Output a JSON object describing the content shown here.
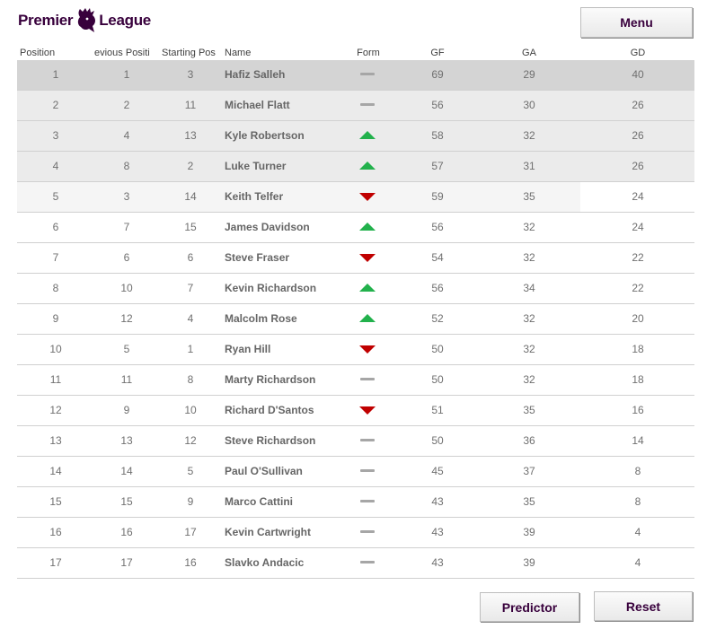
{
  "logo": {
    "word1": "Premier",
    "word2": "League"
  },
  "buttons": {
    "menu": "Menu",
    "predictor": "Predictor",
    "reset": "Reset"
  },
  "colors": {
    "brand": "#38003c",
    "up": "#22b14c",
    "down": "#c00000",
    "same": "#a6a6a6"
  },
  "table": {
    "headers": {
      "position": "Position",
      "previous": "evious Positi",
      "starting": "Starting Pos",
      "name": "Name",
      "form": "Form",
      "gf": "GF",
      "ga": "GA",
      "gd": "GD"
    },
    "rows": [
      {
        "pos": "1",
        "prev": "1",
        "start": "3",
        "name": "Hafiz Salleh",
        "form": "same",
        "gf": "69",
        "ga": "29",
        "gd": "40"
      },
      {
        "pos": "2",
        "prev": "2",
        "start": "11",
        "name": "Michael Flatt",
        "form": "same",
        "gf": "56",
        "ga": "30",
        "gd": "26"
      },
      {
        "pos": "3",
        "prev": "4",
        "start": "13",
        "name": "Kyle Robertson",
        "form": "up",
        "gf": "58",
        "ga": "32",
        "gd": "26"
      },
      {
        "pos": "4",
        "prev": "8",
        "start": "2",
        "name": "Luke Turner",
        "form": "up",
        "gf": "57",
        "ga": "31",
        "gd": "26"
      },
      {
        "pos": "5",
        "prev": "3",
        "start": "14",
        "name": "Keith Telfer",
        "form": "down",
        "gf": "59",
        "ga": "35",
        "gd": "24"
      },
      {
        "pos": "6",
        "prev": "7",
        "start": "15",
        "name": "James Davidson",
        "form": "up",
        "gf": "56",
        "ga": "32",
        "gd": "24"
      },
      {
        "pos": "7",
        "prev": "6",
        "start": "6",
        "name": "Steve Fraser",
        "form": "down",
        "gf": "54",
        "ga": "32",
        "gd": "22"
      },
      {
        "pos": "8",
        "prev": "10",
        "start": "7",
        "name": "Kevin Richardson",
        "form": "up",
        "gf": "56",
        "ga": "34",
        "gd": "22"
      },
      {
        "pos": "9",
        "prev": "12",
        "start": "4",
        "name": "Malcolm Rose",
        "form": "up",
        "gf": "52",
        "ga": "32",
        "gd": "20"
      },
      {
        "pos": "10",
        "prev": "5",
        "start": "1",
        "name": "Ryan Hill",
        "form": "down",
        "gf": "50",
        "ga": "32",
        "gd": "18"
      },
      {
        "pos": "11",
        "prev": "11",
        "start": "8",
        "name": "Marty Richardson",
        "form": "same",
        "gf": "50",
        "ga": "32",
        "gd": "18"
      },
      {
        "pos": "12",
        "prev": "9",
        "start": "10",
        "name": "Richard D'Santos",
        "form": "down",
        "gf": "51",
        "ga": "35",
        "gd": "16"
      },
      {
        "pos": "13",
        "prev": "13",
        "start": "12",
        "name": "Steve Richardson",
        "form": "same",
        "gf": "50",
        "ga": "36",
        "gd": "14"
      },
      {
        "pos": "14",
        "prev": "14",
        "start": "5",
        "name": "Paul O'Sullivan",
        "form": "same",
        "gf": "45",
        "ga": "37",
        "gd": "8"
      },
      {
        "pos": "15",
        "prev": "15",
        "start": "9",
        "name": "Marco Cattini",
        "form": "same",
        "gf": "43",
        "ga": "35",
        "gd": "8"
      },
      {
        "pos": "16",
        "prev": "16",
        "start": "17",
        "name": "Kevin Cartwright",
        "form": "same",
        "gf": "43",
        "ga": "39",
        "gd": "4"
      },
      {
        "pos": "17",
        "prev": "17",
        "start": "16",
        "name": "Slavko Andacic",
        "form": "same",
        "gf": "43",
        "ga": "39",
        "gd": "4"
      }
    ]
  }
}
